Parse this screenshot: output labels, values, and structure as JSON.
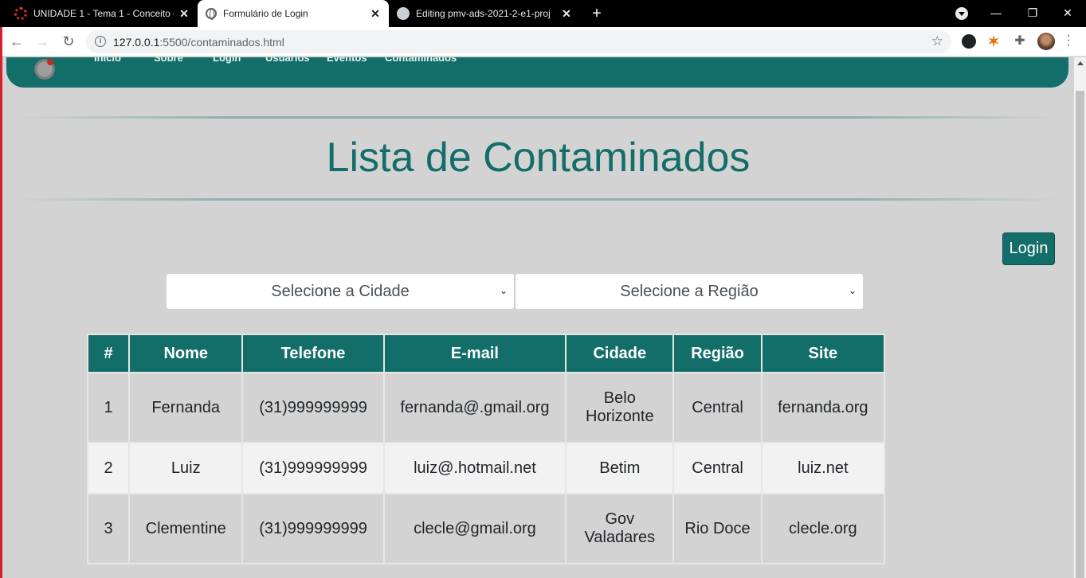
{
  "browser": {
    "tabs": [
      {
        "title": "UNIDADE 1 - Tema 1 - Conceito d",
        "favicon": "loading-ring-icon"
      },
      {
        "title": "Formulário de Login",
        "favicon": "globe-icon"
      },
      {
        "title": "Editing pmv-ads-2021-2-e1-proj",
        "favicon": "github-icon"
      }
    ],
    "url_host": "127.0.0.1",
    "url_path": ":5500/contaminados.html"
  },
  "nav": {
    "items": [
      "Início",
      "Sobre",
      "Login",
      "Usuários",
      "Eventos",
      "Contaminados"
    ]
  },
  "page": {
    "title": "Lista de Contaminados",
    "login_label": "Login"
  },
  "filters": {
    "city_selected": "Selecione a Cidade",
    "region_selected": "Selecione a Região"
  },
  "table": {
    "headers": [
      "#",
      "Nome",
      "Telefone",
      "E-mail",
      "Cidade",
      "Região",
      "Site"
    ],
    "rows": [
      {
        "id": "1",
        "nome": "Fernanda",
        "telefone": "(31)999999999",
        "email": "fernanda@.gmail.org",
        "cidade": "Belo Horizonte",
        "regiao": "Central",
        "site": "fernanda.org"
      },
      {
        "id": "2",
        "nome": "Luiz",
        "telefone": "(31)999999999",
        "email": "luiz@.hotmail.net",
        "cidade": "Betim",
        "regiao": "Central",
        "site": "luiz.net"
      },
      {
        "id": "3",
        "nome": "Clementine",
        "telefone": "(31)999999999",
        "email": "clecle@gmail.org",
        "cidade": "Gov Valadares",
        "regiao": "Rio Doce",
        "site": "clecle.org"
      }
    ]
  },
  "colors": {
    "brand": "#136e69",
    "page_bg": "#d3d3d3",
    "row_alt": "#f2f2f2"
  }
}
